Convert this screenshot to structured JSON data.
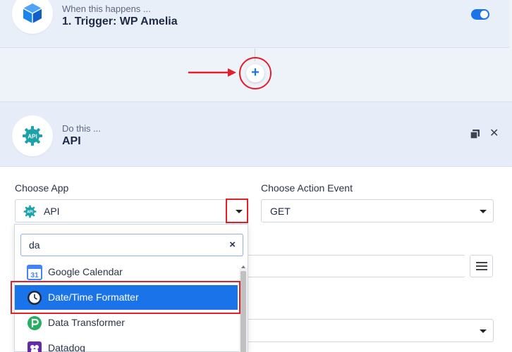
{
  "trigger": {
    "eyebrow": "When this happens ...",
    "title": "1. Trigger: WP Amelia",
    "enabled": true,
    "icon": "wp-amelia-logo-icon"
  },
  "add_step": {
    "label": "+",
    "icon": "plus-icon"
  },
  "action": {
    "eyebrow": "Do this ...",
    "title": "API",
    "icon": "api-gear-icon"
  },
  "form": {
    "choose_app_label": "Choose App",
    "choose_app_value": "API",
    "choose_event_label": "Choose Action Event",
    "choose_event_value": "GET"
  },
  "dropdown": {
    "search_value": "da",
    "clear_label": "×",
    "items": [
      {
        "label": "Google Calendar",
        "icon": "google-calendar-icon",
        "icon_text": "31"
      },
      {
        "label": "Date/Time Formatter",
        "icon": "clock-icon"
      },
      {
        "label": "Data Transformer",
        "icon": "data-transformer-icon"
      },
      {
        "label": "Datadog",
        "icon": "datadog-icon"
      }
    ],
    "selected_index": 1
  },
  "colors": {
    "accent": "#1a73e8",
    "highlight": "#e0202a",
    "card_bg": "#e6edf8"
  }
}
